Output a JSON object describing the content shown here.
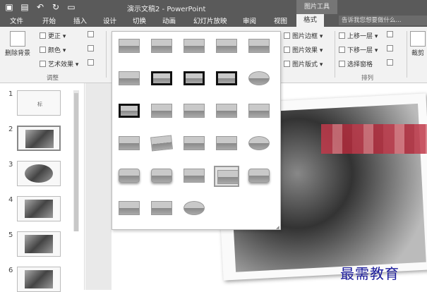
{
  "window": {
    "doc_title": "演示文稿2 - PowerPoint",
    "context_tab_group": "图片工具"
  },
  "tabs": [
    "文件",
    "开始",
    "插入",
    "设计",
    "切换",
    "动画",
    "幻灯片放映",
    "审阅",
    "视图",
    "格式"
  ],
  "search": {
    "placeholder": "告诉我您想要做什么..."
  },
  "ribbon": {
    "remove_bg": "删除背景",
    "adjust": {
      "corrections": "更正 ▾",
      "color": "颜色 ▾",
      "artistic": "艺术效果 ▾",
      "label": "调整"
    },
    "picture_styles": {
      "border": "图片边框 ▾",
      "effects": "图片效果 ▾",
      "layout": "图片版式 ▾"
    },
    "arrange": {
      "bring_forward": "上移一层 ▾",
      "send_backward": "下移一层 ▾",
      "selection_pane": "选择窗格",
      "label": "排列"
    },
    "crop": "裁剪"
  },
  "slides": [
    {
      "num": "1",
      "text": "标"
    },
    {
      "num": "2"
    },
    {
      "num": "3"
    },
    {
      "num": "4"
    },
    {
      "num": "5"
    },
    {
      "num": "6"
    }
  ],
  "gallery": {
    "rows": 6,
    "highlighted_index": 23
  },
  "watermark": "最需教育"
}
